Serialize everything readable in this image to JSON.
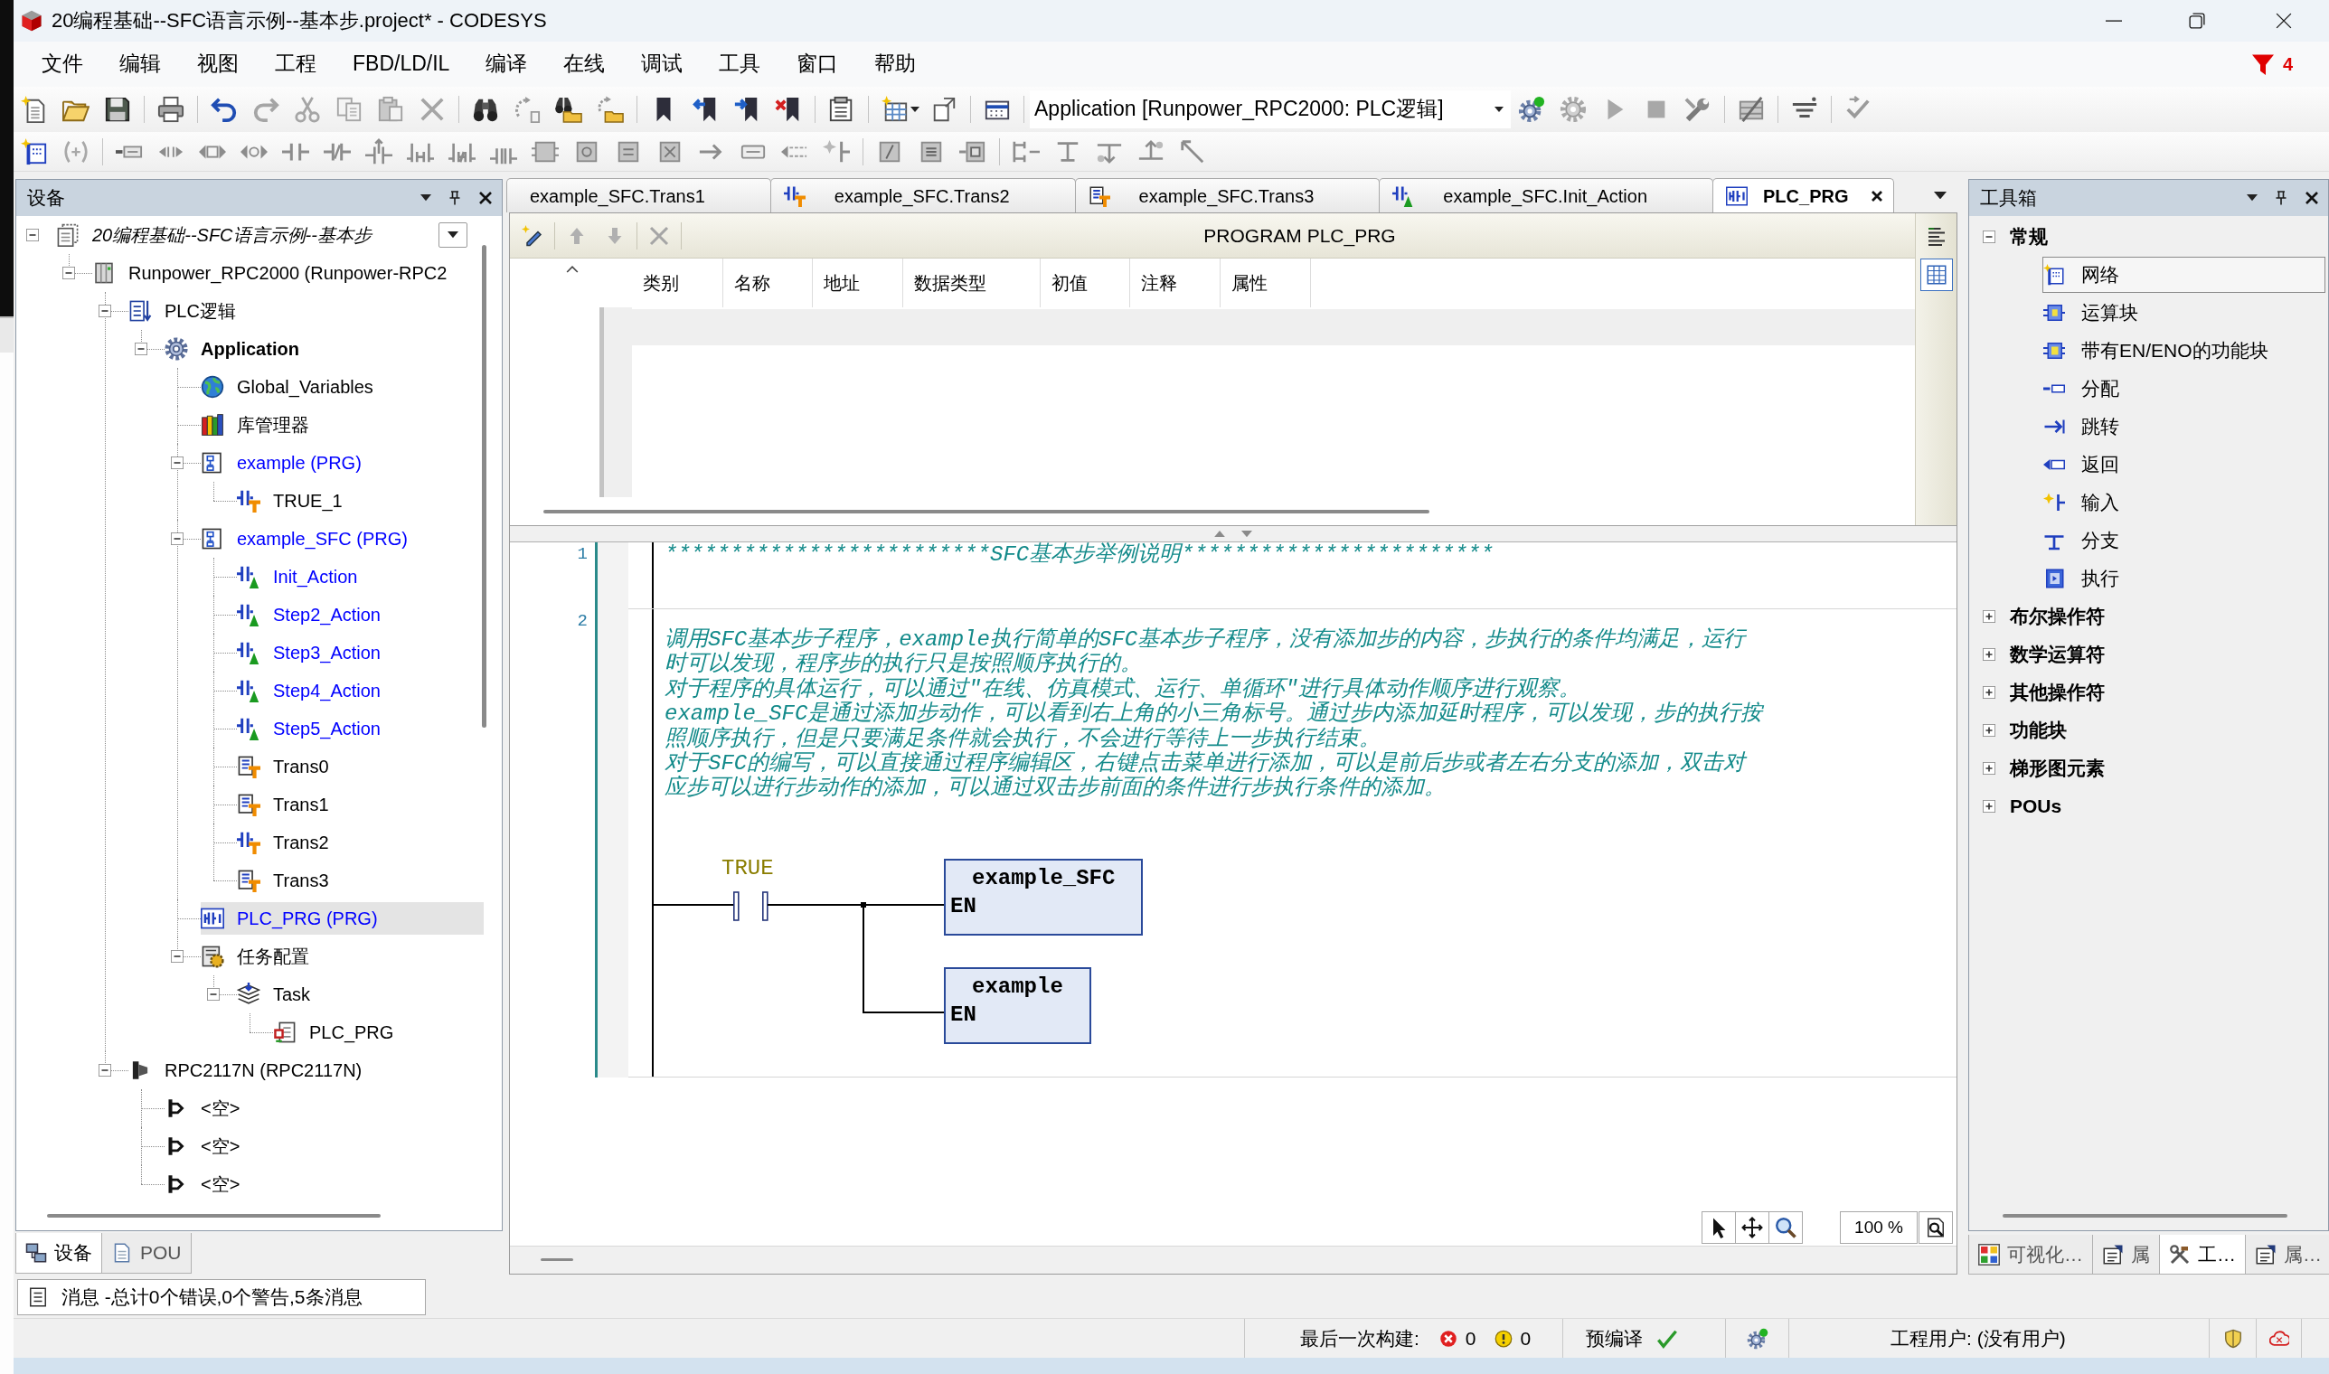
{
  "window": {
    "title": "20编程基础--SFC语言示例--基本步.project* - CODESYS"
  },
  "notification": {
    "count": "4"
  },
  "menu": [
    "文件",
    "编辑",
    "视图",
    "工程",
    "FBD/LD/IL",
    "编译",
    "在线",
    "调试",
    "工具",
    "窗口",
    "帮助"
  ],
  "toolbar": {
    "application": "Application [Runpower_RPC2000: PLC逻辑]"
  },
  "devices": {
    "title": "设备",
    "tree": [
      {
        "label": "20编程基础--SFC语言示例--基本步",
        "kind": "project",
        "color": "#000000",
        "selected": false,
        "expanded": true,
        "children": [
          {
            "label": "Runpower_RPC2000 (Runpower-RPC2",
            "kind": "device",
            "color": "#000000",
            "selected": false,
            "expanded": true,
            "children": [
              {
                "label": "PLC逻辑",
                "kind": "plc-logic",
                "color": "#000000",
                "selected": false,
                "expanded": true,
                "children": [
                  {
                    "label": "Application",
                    "kind": "application",
                    "color": "#000000",
                    "selected": false,
                    "expanded": true,
                    "children": [
                      {
                        "label": "Global_Variables",
                        "kind": "gvl",
                        "color": "#000000",
                        "selected": false
                      },
                      {
                        "label": "库管理器",
                        "kind": "library",
                        "color": "#000000",
                        "selected": false
                      },
                      {
                        "label": "example (PRG)",
                        "kind": "sfc-program",
                        "color": "#0000ff",
                        "selected": false,
                        "expanded": true,
                        "children": [
                          {
                            "label": "TRUE_1",
                            "kind": "ld-transition",
                            "color": "#000000",
                            "selected": false
                          }
                        ]
                      },
                      {
                        "label": "example_SFC (PRG)",
                        "kind": "sfc-program",
                        "color": "#0000ff",
                        "selected": false,
                        "expanded": true,
                        "children": [
                          {
                            "label": "Init_Action",
                            "kind": "ld-action",
                            "color": "#0000ff",
                            "selected": false
                          },
                          {
                            "label": "Step2_Action",
                            "kind": "ld-action",
                            "color": "#0000ff",
                            "selected": false
                          },
                          {
                            "label": "Step3_Action",
                            "kind": "ld-action",
                            "color": "#0000ff",
                            "selected": false
                          },
                          {
                            "label": "Step4_Action",
                            "kind": "ld-action",
                            "color": "#0000ff",
                            "selected": false
                          },
                          {
                            "label": "Step5_Action",
                            "kind": "ld-action",
                            "color": "#0000ff",
                            "selected": false
                          },
                          {
                            "label": "Trans0",
                            "kind": "st-transition",
                            "color": "#000000",
                            "selected": false
                          },
                          {
                            "label": "Trans1",
                            "kind": "st-transition",
                            "color": "#000000",
                            "selected": false
                          },
                          {
                            "label": "Trans2",
                            "kind": "ld-transition",
                            "color": "#000000",
                            "selected": false
                          },
                          {
                            "label": "Trans3",
                            "kind": "st-transition",
                            "color": "#000000",
                            "selected": false
                          }
                        ]
                      },
                      {
                        "label": "PLC_PRG (PRG)",
                        "kind": "ld-program",
                        "color": "#0000ff",
                        "selected": true
                      },
                      {
                        "label": "任务配置",
                        "kind": "task-config",
                        "color": "#000000",
                        "selected": false,
                        "expanded": true,
                        "children": [
                          {
                            "label": "Task",
                            "kind": "task",
                            "color": "#000000",
                            "selected": false,
                            "expanded": true,
                            "children": [
                              {
                                "label": "PLC_PRG",
                                "kind": "program-call",
                                "color": "#000000",
                                "selected": false
                              }
                            ]
                          }
                        ]
                      }
                    ]
                  }
                ]
              },
              {
                "label": "RPC2117N (RPC2117N)",
                "kind": "io-module",
                "color": "#000000",
                "selected": false,
                "expanded": true,
                "children": [
                  {
                    "label": "<空>",
                    "kind": "slot",
                    "color": "#000000",
                    "selected": false
                  },
                  {
                    "label": "<空>",
                    "kind": "slot",
                    "color": "#000000",
                    "selected": false
                  },
                  {
                    "label": "<空>",
                    "kind": "slot",
                    "color": "#000000",
                    "selected": false
                  }
                ]
              }
            ]
          }
        ]
      }
    ],
    "tabs": [
      {
        "label": "设备",
        "kind": "devices",
        "selected": true
      },
      {
        "label": "POU",
        "kind": "pou",
        "selected": false
      }
    ]
  },
  "messages": {
    "label": "消息 -总计0个错误,0个警告,5条消息"
  },
  "editor": {
    "tabs": [
      {
        "label": "example_SFC.Trans1",
        "kind": "plain",
        "selected": false
      },
      {
        "label": "example_SFC.Trans2",
        "kind": "ld-transition",
        "selected": false
      },
      {
        "label": "example_SFC.Trans3",
        "kind": "st-transition",
        "selected": false
      },
      {
        "label": "example_SFC.Init_Action",
        "kind": "ld-action",
        "selected": false
      },
      {
        "label": "PLC_PRG",
        "kind": "ld-program",
        "selected": true
      }
    ],
    "declaration": {
      "title": "PROGRAM PLC_PRG",
      "columns": [
        "类别",
        "名称",
        "地址",
        "数据类型",
        "初值",
        "注释",
        "属性"
      ],
      "views": [
        {
          "kind": "text",
          "selected": false
        },
        {
          "kind": "table",
          "selected": true
        }
      ]
    },
    "networks": [
      {
        "number": "1",
        "comment_lines": [
          "*************************SFC基本步举例说明************************"
        ]
      },
      {
        "number": "2",
        "comment_lines": [
          "调用SFC基本步子程序，example执行简单的SFC基本步子程序，没有添加步的内容，步执行的条件均满足，运行",
          "时可以发现，程序步的执行只是按照顺序执行的。",
          "对于程序的具体运行，可以通过\"在线、仿真模式、运行、单循环\"进行具体动作顺序进行观察。",
          "example_SFC是通过添加步动作，可以看到右上角的小三角标号。通过步内添加延时程序，可以发现，步的执行按",
          "照顺序执行，但是只要满足条件就会执行，不会进行等待上一步执行结束。",
          "对于SFC的编写，可以直接通过程序编辑区，右键点击菜单进行添加，可以是前后步或者左右分支的添加，双击对",
          "应步可以进行步动作的添加，可以通过双击步前面的条件进行步执行条件的添加。"
        ],
        "contact": "TRUE",
        "blocks": [
          {
            "name": "example_SFC",
            "input": "EN"
          },
          {
            "name": "example",
            "input": "EN"
          }
        ]
      }
    ],
    "zoom": "100 %"
  },
  "toolbox": {
    "title": "工具箱",
    "groups": [
      {
        "label": "常规",
        "expanded": true,
        "items": [
          {
            "label": "网络",
            "kind": "network",
            "selected": true
          },
          {
            "label": "运算块",
            "kind": "box",
            "selected": false
          },
          {
            "label": "带有EN/ENO的功能块",
            "kind": "box-en",
            "selected": false
          },
          {
            "label": "分配",
            "kind": "assignment",
            "selected": false
          },
          {
            "label": "跳转",
            "kind": "jump",
            "selected": false
          },
          {
            "label": "返回",
            "kind": "return",
            "selected": false
          },
          {
            "label": "输入",
            "kind": "input",
            "selected": false
          },
          {
            "label": "分支",
            "kind": "branch",
            "selected": false
          },
          {
            "label": "执行",
            "kind": "execute",
            "selected": false
          }
        ]
      },
      {
        "label": "布尔操作符",
        "expanded": false
      },
      {
        "label": "数学运算符",
        "expanded": false
      },
      {
        "label": "其他操作符",
        "expanded": false
      },
      {
        "label": "功能块",
        "expanded": false
      },
      {
        "label": "梯形图元素",
        "expanded": false
      },
      {
        "label": "POUs",
        "expanded": false
      }
    ],
    "tabs": [
      {
        "label": "可视化…",
        "kind": "visualization",
        "selected": false
      },
      {
        "label": "属",
        "kind": "properties",
        "selected": false
      },
      {
        "label": "工…",
        "kind": "tools",
        "selected": true
      },
      {
        "label": "属…",
        "kind": "properties",
        "selected": false
      }
    ]
  },
  "status_bar": {
    "build_label": "最后一次构建:",
    "errors": "0",
    "warnings": "0",
    "precompile": "预编译",
    "precompile_ok": true,
    "user": "工程用户: (没有用户)"
  }
}
